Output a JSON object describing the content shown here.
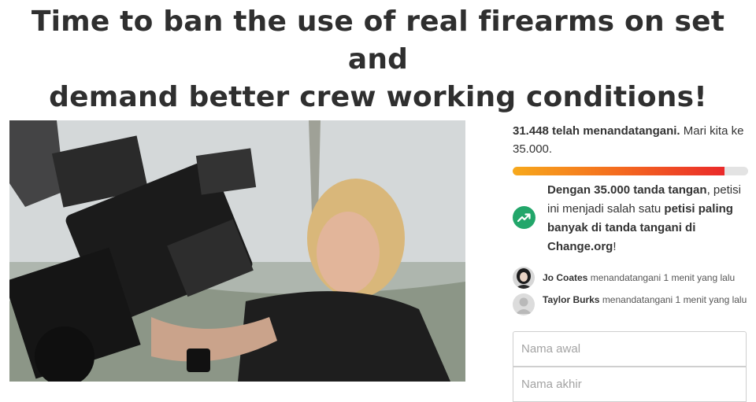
{
  "title": {
    "line1": "Time to ban the use of real firearms on set and",
    "line2": "demand better crew working conditions!"
  },
  "signatures": {
    "count_text": "31.448 telah menandatangani.",
    "goal_text": "Mari kita ke 35.000.",
    "progress_fraction": 0.9
  },
  "milestone": {
    "part1": "Dengan 35.000 tanda tangan",
    "part2": ", petisi ini menjadi salah satu ",
    "part3": "petisi paling banyak di tanda tangani di Change.org",
    "part4": "!",
    "icon": "trending-up-icon"
  },
  "recent_signers": [
    {
      "name": "Jo Coates",
      "action": "menandatangani 1 menit yang lalu"
    },
    {
      "name": "Taylor Burks",
      "action": "menandatangani 1 menit yang lalu"
    }
  ],
  "form": {
    "first_name_placeholder": "Nama awal",
    "last_name_placeholder": "Nama akhir"
  },
  "colors": {
    "progress_start": "#f7a91c",
    "progress_end": "#ea2a2a",
    "trend_icon_bg": "#22a66a"
  }
}
